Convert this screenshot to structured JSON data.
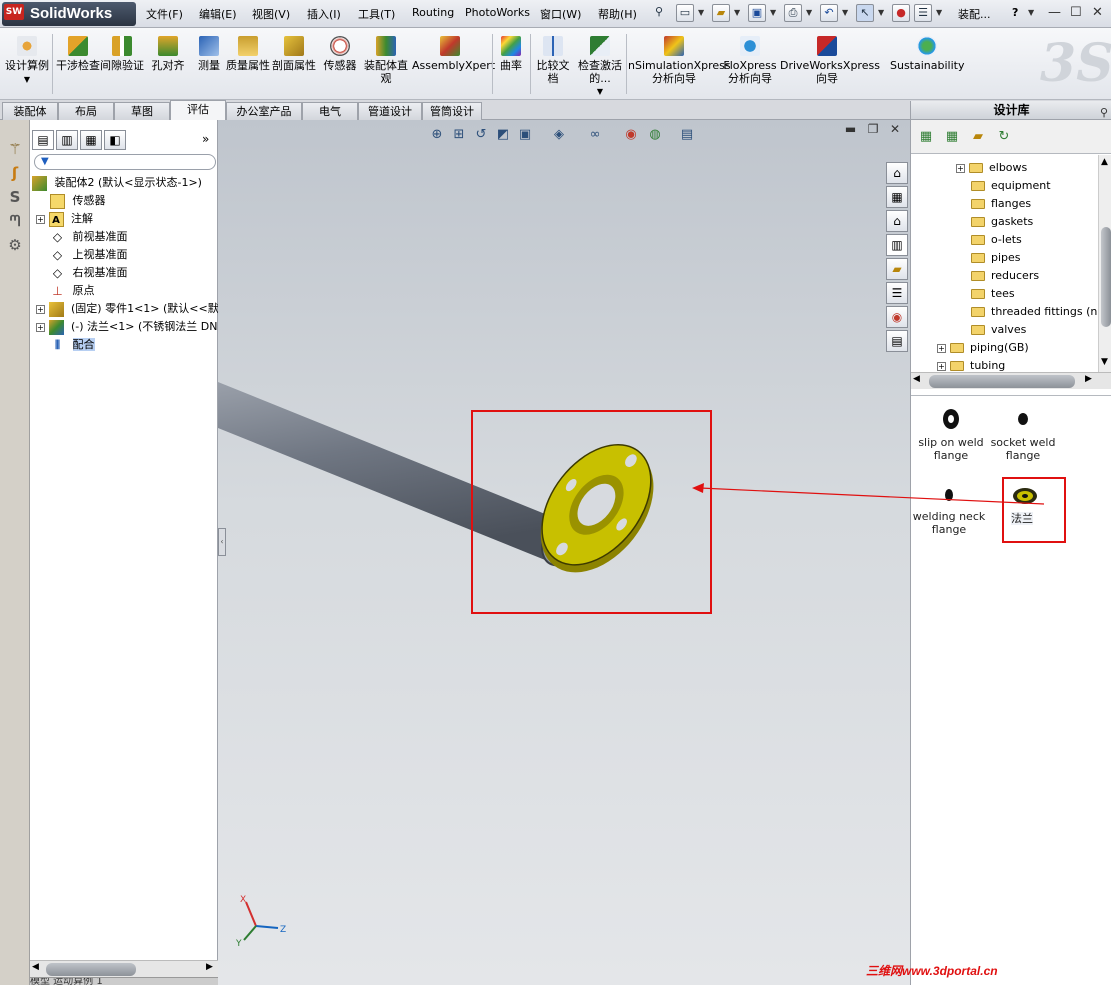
{
  "app": {
    "name": "SolidWorks",
    "logo_mark": "SW"
  },
  "menu": {
    "items": [
      "文件(F)",
      "编辑(E)",
      "视图(V)",
      "插入(I)",
      "工具(T)",
      "Routing",
      "PhotoWorks",
      "窗口(W)",
      "帮助(H)"
    ],
    "doc_title": "装配...",
    "help": "?"
  },
  "ribbon": {
    "buttons": [
      {
        "label": "设计算例",
        "icon": "design-study-icon"
      },
      {
        "label": "干涉检查",
        "icon": "interference-check-icon"
      },
      {
        "label": "间隙验证",
        "icon": "clearance-verification-icon"
      },
      {
        "label": "孔对齐",
        "icon": "hole-alignment-icon"
      },
      {
        "label": "测量",
        "icon": "measure-icon"
      },
      {
        "label": "质量属性",
        "icon": "mass-properties-icon"
      },
      {
        "label": "剖面属性",
        "icon": "section-properties-icon"
      },
      {
        "label": "传感器",
        "icon": "sensor-icon"
      },
      {
        "label": "装配体直观",
        "icon": "assembly-visualization-icon"
      },
      {
        "label": "AssemblyXpert",
        "icon": "assemblyxpert-icon"
      },
      {
        "label": "曲率",
        "icon": "curvature-icon"
      },
      {
        "label": "比较文档",
        "icon": "compare-documents-icon"
      },
      {
        "label": "检查激活的...",
        "icon": "check-active-icon"
      },
      {
        "label": "nSimulationXpress分析向导",
        "icon": "simulationxpress-icon"
      },
      {
        "label": "FloXpress分析向导",
        "icon": "floxpress-icon"
      },
      {
        "label": "DriveWorksXpress向导",
        "icon": "driveworksxpress-icon"
      },
      {
        "label": "Sustainability",
        "icon": "sustainability-icon"
      }
    ]
  },
  "tabs": [
    "装配体",
    "布局",
    "草图",
    "评估",
    "办公室产品",
    "电气",
    "管道设计",
    "管筒设计"
  ],
  "active_tab": "评估",
  "feature_tree": {
    "filter_icon": "filter-icon",
    "items": [
      {
        "label": "装配体2 (默认<显示状态-1>)",
        "icon": "assembly-icon",
        "expander": ""
      },
      {
        "label": "传感器",
        "icon": "sensor-folder-icon",
        "expander": ""
      },
      {
        "label": "注解",
        "icon": "annotations-icon",
        "expander": "+"
      },
      {
        "label": "前视基准面",
        "icon": "plane-icon",
        "expander": ""
      },
      {
        "label": "上视基准面",
        "icon": "plane-icon",
        "expander": ""
      },
      {
        "label": "右视基准面",
        "icon": "plane-icon",
        "expander": ""
      },
      {
        "label": "原点",
        "icon": "origin-icon",
        "expander": ""
      },
      {
        "label": "(固定) 零件1<1> (默认<<默",
        "icon": "part-icon",
        "expander": "+"
      },
      {
        "label": "(-) 法兰<1> (不锈钢法兰 DN",
        "icon": "sub-assembly-icon",
        "expander": "+"
      },
      {
        "label": "配合",
        "icon": "mates-icon",
        "expander": ""
      }
    ],
    "bottom_tabs": "模型   运动算例 1"
  },
  "design_library": {
    "title": "设计库",
    "tree": [
      {
        "label": "elbows",
        "indent": 2,
        "expander": "+"
      },
      {
        "label": "equipment",
        "indent": 2,
        "expander": ""
      },
      {
        "label": "flanges",
        "indent": 2,
        "expander": ""
      },
      {
        "label": "gaskets",
        "indent": 2,
        "expander": ""
      },
      {
        "label": "o-lets",
        "indent": 2,
        "expander": ""
      },
      {
        "label": "pipes",
        "indent": 2,
        "expander": ""
      },
      {
        "label": "reducers",
        "indent": 2,
        "expander": ""
      },
      {
        "label": "tees",
        "indent": 2,
        "expander": ""
      },
      {
        "label": "threaded fittings (npt)",
        "indent": 2,
        "expander": ""
      },
      {
        "label": "valves",
        "indent": 2,
        "expander": ""
      },
      {
        "label": "piping(GB)",
        "indent": 1,
        "expander": "+"
      },
      {
        "label": "tubing",
        "indent": 1,
        "expander": "+"
      }
    ],
    "items": [
      {
        "label": "slip on weld flange",
        "icon": "slip-on-flange-icon"
      },
      {
        "label": "socket weld flange",
        "icon": "socket-weld-flange-icon"
      },
      {
        "label": "welding neck flange",
        "icon": "welding-neck-flange-icon"
      },
      {
        "label": "法兰",
        "icon": "flange-icon"
      }
    ]
  },
  "colors": {
    "accent_red": "#e01010",
    "flange_yellow": "#c8c000",
    "pipe_gray": "#6f7682"
  },
  "watermark": "三维网www.3dportal.cn",
  "triad_labels": {
    "x": "X",
    "y": "Y",
    "z": "Z"
  }
}
